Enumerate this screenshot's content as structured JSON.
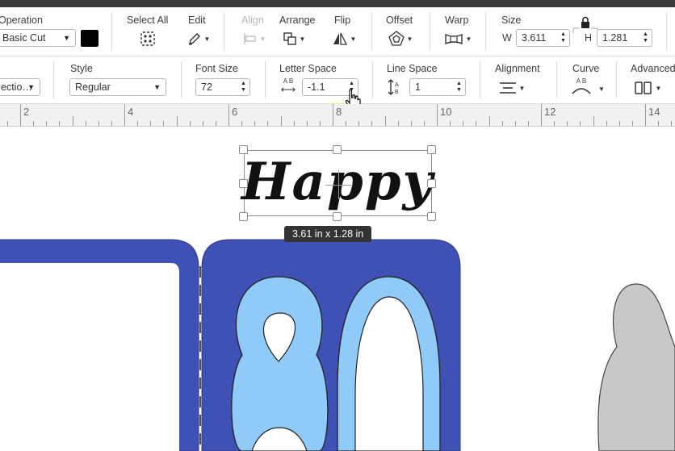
{
  "colors": {
    "accent": "#3f51b5",
    "light_blue": "#90caf9",
    "grey_shape": "#c8c8c8",
    "highlight": "#ffff66"
  },
  "toolbar1": {
    "operation_label": "Operation",
    "operation_value": "Basic Cut",
    "select_all_label": "Select All",
    "edit_label": "Edit",
    "align_label": "Align",
    "arrange_label": "Arrange",
    "flip_label": "Flip",
    "offset_label": "Offset",
    "warp_label": "Warp",
    "size_label": "Size",
    "width_prefix": "W",
    "width_value": "3.611",
    "height_prefix": "H",
    "height_value": "1.281"
  },
  "toolbar2": {
    "font_partial": "ectio…",
    "style_label": "Style",
    "style_value": "Regular",
    "font_size_label": "Font Size",
    "font_size_value": "72",
    "letter_space_label": "Letter Space",
    "letter_space_value": "-1.1",
    "line_space_label": "Line Space",
    "line_space_value": "1",
    "alignment_label": "Alignment",
    "curve_label": "Curve",
    "advanced_label": "Advanced",
    "ab_glyph": "A B"
  },
  "ruler": {
    "numbers": [
      "2",
      "4",
      "6",
      "8",
      "10",
      "12",
      "14"
    ]
  },
  "canvas": {
    "text_object": "Happy",
    "size_readout": "3.61  in x 1.28  in",
    "digits": "80"
  }
}
